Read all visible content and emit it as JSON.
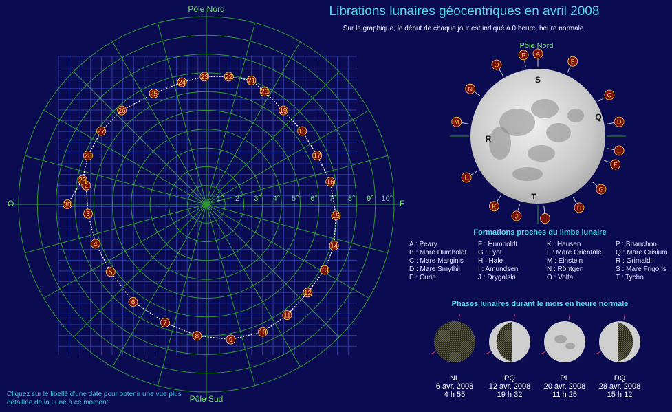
{
  "header": {
    "title": "Librations lunaires géocentriques en avril 2008",
    "subtitle": "Sur le graphique, le début de chaque jour est indiqué à 0 heure, heure normale."
  },
  "polar": {
    "north_label": "Pôle Nord",
    "south_label": "Pôle Sud",
    "west_label": "O",
    "east_label": "E",
    "ring_labels": [
      "1°",
      "2°",
      "3°",
      "4°",
      "5°",
      "6°",
      "7°",
      "8°",
      "9°",
      "10°"
    ]
  },
  "chart_data": {
    "type": "scatter",
    "title": "Librations lunaires géocentriques en avril 2008",
    "xlabel": "O — E",
    "ylabel": "Pôle Sud — Pôle Nord",
    "xlim": [
      -10,
      10
    ],
    "ylim": [
      -10,
      10
    ],
    "units": "°",
    "grid": true,
    "series": [
      {
        "days": [
          "2",
          "3",
          "4",
          "5",
          "6",
          "7",
          "8",
          "9",
          "10",
          "11",
          "12",
          "13",
          "14",
          "15",
          "16",
          "17",
          "18",
          "19",
          "20",
          "21",
          "22",
          "23",
          "24",
          "25",
          "26",
          "27",
          "28",
          "29",
          "30"
        ],
        "x": [
          -6.4,
          -6.3,
          -5.9,
          -5.1,
          -3.9,
          -2.2,
          -0.5,
          1.3,
          3.0,
          4.3,
          5.4,
          6.3,
          6.8,
          6.9,
          6.6,
          5.9,
          5.1,
          4.1,
          3.1,
          2.4,
          1.2,
          -0.1,
          -1.3,
          -2.8,
          -4.5,
          -5.6,
          -6.3,
          -6.6,
          -7.4
        ],
        "y": [
          1.0,
          -0.5,
          -2.1,
          -3.6,
          -5.2,
          -6.3,
          -7.0,
          -7.2,
          -6.8,
          -5.9,
          -4.7,
          -3.5,
          -2.2,
          -0.6,
          1.2,
          2.6,
          3.9,
          5.0,
          6.0,
          6.6,
          6.8,
          6.8,
          6.5,
          5.9,
          5.0,
          3.9,
          2.6,
          1.3,
          0.0
        ]
      }
    ]
  },
  "moon": {
    "north_label": "Pôle Nord",
    "center_letters": [
      "S",
      "R",
      "Q",
      "T"
    ],
    "rim_markers": [
      "A",
      "B",
      "C",
      "D",
      "E",
      "F",
      "G",
      "H",
      "I",
      "J",
      "K",
      "L",
      "M",
      "N",
      "O",
      "P"
    ]
  },
  "landmarks": {
    "title": "Formations proches du limbe lunaire",
    "items": [
      "A : Peary",
      "F : Humboldt",
      "K : Hausen",
      "P : Brianchon",
      "B : Mare Humboldt.",
      "G : Lyot",
      "L : Mare Orientale",
      "Q : Mare Crisium",
      "C : Mare Marginis",
      "H : Hale",
      "M : Einstein",
      "R : Grimaldi",
      "D : Mare Smythii",
      "I : Amundsen",
      "N : Röntgen",
      "S : Mare Frigoris",
      "E : Curie",
      "J : Drygalski",
      "O : Volta",
      "T : Tycho"
    ]
  },
  "phases": {
    "title": "Phases lunaires durant le mois en heure normale",
    "items": [
      {
        "code": "NL",
        "date": "6 avr. 2008",
        "time": "4 h 55",
        "illum": 0.0
      },
      {
        "code": "PQ",
        "date": "12 avr. 2008",
        "time": "19 h 32",
        "illum": 0.5
      },
      {
        "code": "PL",
        "date": "20 avr. 2008",
        "time": "11 h 25",
        "illum": 1.0
      },
      {
        "code": "DQ",
        "date": "28 avr. 2008",
        "time": "15 h 12",
        "illum": 0.5
      }
    ]
  },
  "hint": "Cliquez sur le libellé d'une date pour obtenir une vue plus détaillée de la Lune à ce moment.",
  "colors": {
    "background": "#0b0b52",
    "grid_green": "#2f9a2f",
    "grid_blue": "#2a3aa8",
    "marker_fill": "#7a1010",
    "marker_text": "#ffd24a",
    "title_cyan": "#4fd8e8"
  }
}
